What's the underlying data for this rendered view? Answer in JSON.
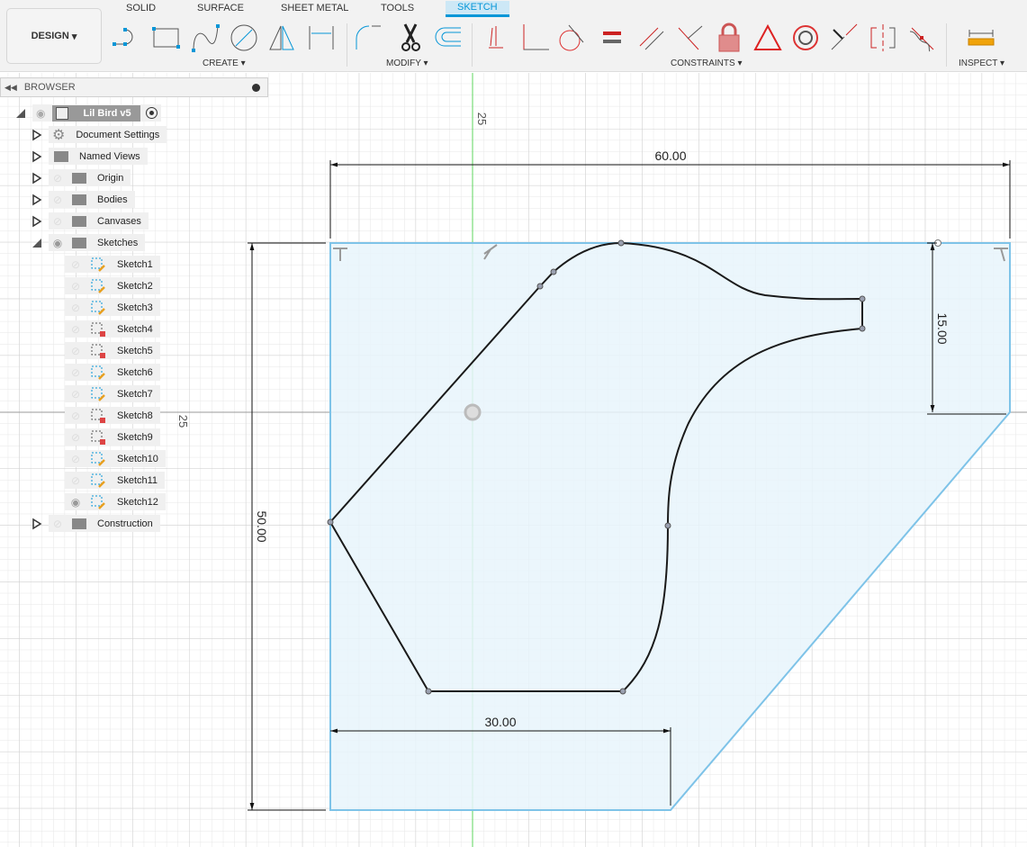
{
  "toolbar": {
    "workspace": "DESIGN",
    "tabs": [
      "SOLID",
      "SURFACE",
      "SHEET METAL",
      "TOOLS",
      "SKETCH"
    ],
    "active_tab": "SKETCH",
    "groups": {
      "create": "CREATE",
      "modify": "MODIFY",
      "constraints": "CONSTRAINTS",
      "inspect": "INSPECT"
    }
  },
  "browser": {
    "title": "BROWSER",
    "root": "Lil Bird v5",
    "items": [
      {
        "label": "Document Settings",
        "icon": "gear-icon"
      },
      {
        "label": "Named Views",
        "icon": "folder-icon"
      },
      {
        "label": "Origin",
        "icon": "folder-icon",
        "visible": false
      },
      {
        "label": "Bodies",
        "icon": "folder-icon",
        "visible": false
      },
      {
        "label": "Canvases",
        "icon": "folder-icon",
        "visible": false
      },
      {
        "label": "Sketches",
        "icon": "folder-icon",
        "visible": true,
        "expanded": true
      }
    ],
    "sketches": [
      {
        "label": "Sketch1",
        "locked": false,
        "visible": false
      },
      {
        "label": "Sketch2",
        "locked": false,
        "visible": false
      },
      {
        "label": "Sketch3",
        "locked": false,
        "visible": false
      },
      {
        "label": "Sketch4",
        "locked": true,
        "visible": false
      },
      {
        "label": "Sketch5",
        "locked": true,
        "visible": false
      },
      {
        "label": "Sketch6",
        "locked": false,
        "visible": false
      },
      {
        "label": "Sketch7",
        "locked": false,
        "visible": false
      },
      {
        "label": "Sketch8",
        "locked": true,
        "visible": false
      },
      {
        "label": "Sketch9",
        "locked": true,
        "visible": false
      },
      {
        "label": "Sketch10",
        "locked": false,
        "visible": false
      },
      {
        "label": "Sketch11",
        "locked": false,
        "visible": false
      },
      {
        "label": "Sketch12",
        "locked": false,
        "visible": true
      }
    ],
    "construction": "Construction"
  },
  "canvas": {
    "dimensions": {
      "top": "60.00",
      "right": "15.00",
      "left": "50.00",
      "bottom": "30.00"
    },
    "axis_labels": {
      "vertical": "25",
      "horizontal": "25"
    },
    "colors": {
      "profile": "#1a1a1a",
      "region": "#e8f4fb",
      "region_border": "#7ec3e8",
      "y_axis": "#5cd65c",
      "x_axis": "#d98b8b",
      "accent": "#0696d7"
    }
  }
}
